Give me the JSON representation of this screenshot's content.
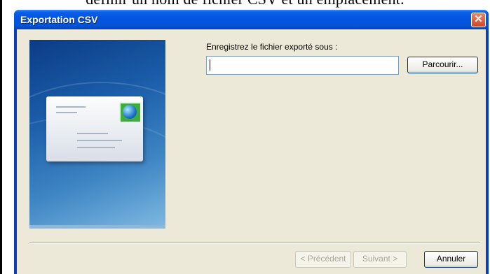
{
  "background_doc": {
    "text": "définir un nom de fichier CSV et un emplacement."
  },
  "window": {
    "title": "Exportation CSV",
    "close_glyph": "✕",
    "title_gradient": "#0553e0",
    "body_color": "#ece9d8"
  },
  "form": {
    "label": "Enregistrez le fichier exporté sous :",
    "path_value": "",
    "browse_button": "Parcourir..."
  },
  "footer": {
    "back_button": "< Précédent",
    "next_button": "Suivant >",
    "cancel_button": "Annuler"
  },
  "illustration": {
    "icon": "envelope-icon",
    "stamp": "globe-icon"
  }
}
